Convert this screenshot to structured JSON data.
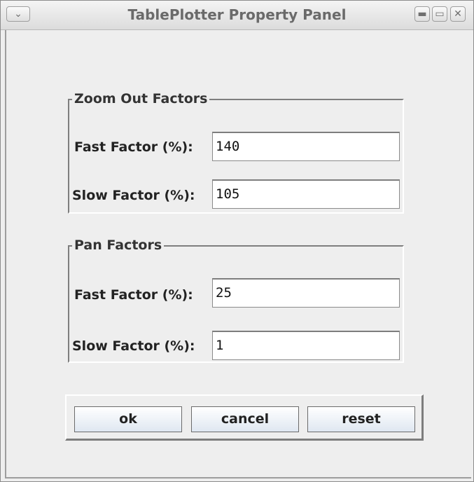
{
  "window": {
    "title": "TablePlotter Property Panel",
    "menu_icon": "chevron-down-icon",
    "controls": [
      "minimize-icon",
      "maximize-icon",
      "close-icon"
    ]
  },
  "zoom_group": {
    "title": "Zoom Out Factors",
    "fast_label": "Fast Factor (%):",
    "fast_value": "140",
    "slow_label": "Slow Factor (%):",
    "slow_value": "105"
  },
  "pan_group": {
    "title": "Pan Factors",
    "fast_label": "Fast Factor (%):",
    "fast_value": "25",
    "slow_label": "Slow Factor (%):",
    "slow_value": "1"
  },
  "buttons": {
    "ok": "ok",
    "cancel": "cancel",
    "reset": "reset"
  }
}
